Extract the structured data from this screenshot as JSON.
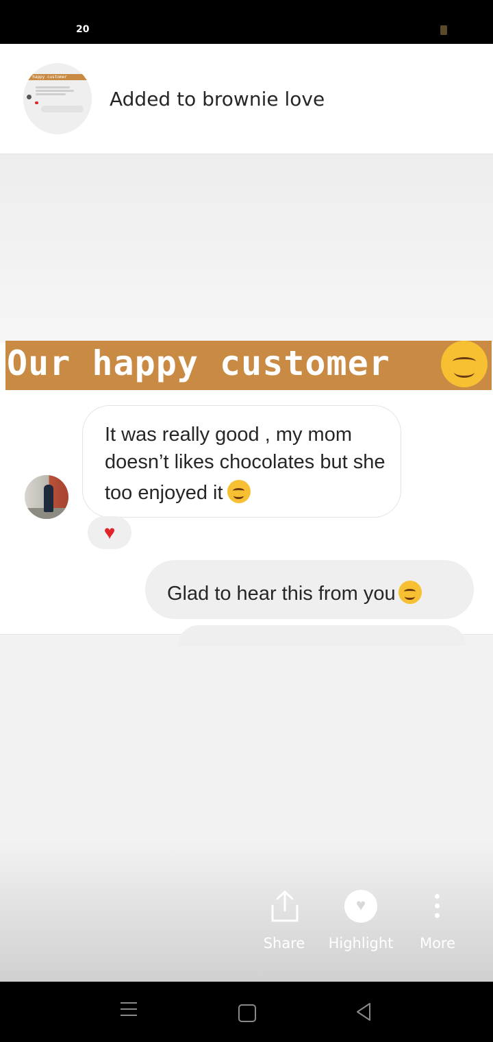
{
  "status_bar": {
    "time": "20"
  },
  "toast": {
    "title": "Added to brownie love",
    "thumbnail_banner": "r happy customer"
  },
  "story": {
    "banner_text": "Our happy customer",
    "received_message": "It was really good , my mom doesn’t likes chocolates but she too enjoyed it",
    "reaction_icon": "heart",
    "sent_message": "Glad to hear this from you"
  },
  "actions": [
    {
      "label": "Share",
      "icon": "share-icon"
    },
    {
      "label": "Highlight",
      "icon": "heart-icon"
    },
    {
      "label": "More",
      "icon": "more-vertical-icon"
    }
  ],
  "colors": {
    "banner": "#c98a44",
    "reaction": "#e0242a"
  }
}
